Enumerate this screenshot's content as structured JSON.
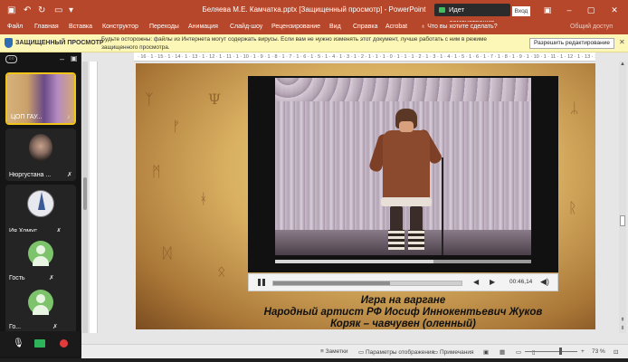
{
  "titlebar": {
    "title": "Беляева М.Е. Камчатка.pptx [Защищенный просмотр] - PowerPoint",
    "demo_label": "Идет демонстрация",
    "signin_label": "Вход",
    "accent": "#b7472a"
  },
  "ribbon": {
    "tabs": [
      "Файл",
      "Главная",
      "Вставка",
      "Конструктор",
      "Переходы",
      "Анимация",
      "Слайд-шоу",
      "Рецензирование",
      "Вид",
      "Справка",
      "Acrobat"
    ],
    "tell_me": "Что вы хотите сделать?",
    "share": "Общий доступ"
  },
  "protected_view": {
    "title": "ЗАЩИЩЕННЫЙ ПРОСМОТР",
    "message": "Будьте осторожны: файлы из Интернета могут содержать вирусы. Если вам не нужно изменять этот документ, лучше работать с ним в режиме защищенного просмотра.",
    "enable_button": "Разрешить редактирование",
    "background": "#fcf7b6"
  },
  "ruler": {
    "marks": "· 16 · 1 · 15 · 1 · 14 · 1 · 13 · 1 · 12 · 1 · 11 · 1 · 10 · 1 · 9 · 1 · 8 · 1 · 7 · 1 · 6 · 1 · 5 · 1 · 4 · 1 · 3 · 1 · 2 · 1 · 1 · 1 · 0 · 1 · 1 · 1 · 2 · 1 · 3 · 1 · 4 · 1 · 5 · 1 · 6 · 1 · 7 · 1 · 8 · 1 · 9 · 1 · 10 · 1 · 11 · 1 · 12 · 1 · 13 · 1 · 14 · 1 · 15 · 1 · 16 ·"
  },
  "video": {
    "time": "00:46,14",
    "progress_fraction": 0.62
  },
  "slide": {
    "caption_line1": "Игра на варгане",
    "caption_line2": "Народный артист РФ Иосиф Иннокентьевич Жуков",
    "caption_line3": "Коряк – чавчувен (оленный)"
  },
  "zoom": {
    "participants": [
      {
        "name": "ЦОП ГАУ...",
        "active": true
      },
      {
        "name": "Нюргустана ...",
        "active": false
      },
      {
        "name": "Ия Хомус",
        "active": false
      },
      {
        "name": "Гость",
        "active": false
      },
      {
        "name": "Го...",
        "active": false
      }
    ]
  },
  "statusbar": {
    "notes": "Заметки",
    "display_settings": "Параметры отображения",
    "comments": "Примечания",
    "zoom": "73 %"
  }
}
